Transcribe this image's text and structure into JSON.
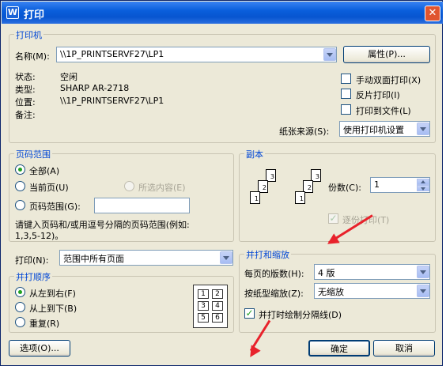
{
  "window": {
    "title": "打印",
    "app_icon": "W"
  },
  "printer_group": {
    "title": "打印机",
    "name_label": "名称(M):",
    "name_value": "\\\\1P_PRINTSERVF27\\LP1",
    "properties_button": "属性(P)...",
    "status_label": "状态:",
    "status_value": "空闲",
    "type_label": "类型:",
    "type_value": "SHARP AR-2718",
    "location_label": "位置:",
    "location_value": "\\\\1P_PRINTSERVF27\\LP1",
    "comment_label": "备注:",
    "manual_duplex": "手动双面打印(X)",
    "reverse_print": "反片打印(I)",
    "print_to_file": "打印到文件(L)",
    "paper_source_label": "纸张来源(S):",
    "paper_source_value": "使用打印机设置"
  },
  "page_range": {
    "title": "页码范围",
    "all": "全部(A)",
    "current_page": "当前页(U)",
    "selection": "所选内容(E)",
    "pages": "页码范围(G):",
    "pages_value": "",
    "hint_line1": "请键入页码和/或用逗号分隔的页码范围(例如:",
    "hint_line2": "1,3,5-12)。",
    "selected": "all"
  },
  "print_what": {
    "label": "打印(N):",
    "value": "范围中所有页面"
  },
  "print_order": {
    "title": "并打顺序",
    "left_to_right": "从左到右(F)",
    "top_to_bottom": "从上到下(B)",
    "repeat": "重复(R)",
    "selected": "left_to_right",
    "cells": [
      "1",
      "2",
      "3",
      "4",
      "5",
      "6"
    ]
  },
  "copies": {
    "title": "副本",
    "count_label": "份数(C):",
    "count_value": "1",
    "collate": "逐份打印(T)",
    "collate_checked": true
  },
  "zoom": {
    "title": "并打和缩放",
    "pages_per_sheet_label": "每页的版数(H):",
    "pages_per_sheet_value": "4 版",
    "scale_label": "按纸型缩放(Z):",
    "scale_value": "无缩放",
    "draw_borders": "并打时绘制分隔线(D)",
    "draw_borders_checked": true
  },
  "footer": {
    "options": "选项(O)...",
    "ok": "确定",
    "cancel": "取消"
  },
  "colors": {
    "accent": "#0046d5",
    "annotation_arrow": "#e8222b",
    "check": "#21a121"
  }
}
